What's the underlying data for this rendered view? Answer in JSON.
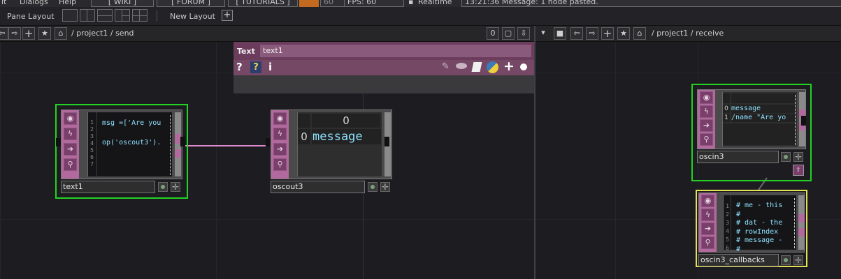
{
  "menubar": {
    "items": [
      "it",
      "Dialogs",
      "Help"
    ],
    "buttons": [
      "[ WIKI ]",
      "[ FORUM ]",
      "[ TUTORIALS ]",
      "60",
      "FPS:  60"
    ],
    "realtime_label": "Realtime",
    "status_message": "13:21:36 Message: 1 node pasted."
  },
  "layoutbar": {
    "pane_layout_label": "Pane Layout",
    "new_layout_label": "New Layout",
    "plus": "+"
  },
  "left_pane": {
    "path": "/ project1 / send",
    "zero_button": "0"
  },
  "right_pane": {
    "path": "/ project1 / receive"
  },
  "params": {
    "type_label": "Text",
    "name_value": "text1",
    "help_q": "?",
    "help_py": "?",
    "info": "i"
  },
  "nodes": {
    "text1": {
      "name": "text1",
      "line_numbers": [
        "1",
        "2",
        "3",
        "4",
        "5",
        "6",
        "7"
      ],
      "code": "msg =['Are you\n\nop('oscout3')."
    },
    "oscout3": {
      "name": "oscout3",
      "col_header": "0",
      "row_index": "0",
      "cell": "message"
    },
    "oscin3": {
      "name": "oscin3",
      "row_indices": [
        "0",
        "1"
      ],
      "rows": [
        "message",
        "/name \"Are yo"
      ]
    },
    "oscin3_callbacks": {
      "name": "oscin3_callbacks",
      "line_numbers": [
        "1",
        "2",
        "3",
        "4",
        "5",
        "6"
      ],
      "code": "# me - this\n#\n# dat - the\n# rowIndex\n# message -\n#"
    }
  },
  "colors": {
    "dat_family": "#b26a9e",
    "selected": "#23d323",
    "current": "#e6e055",
    "wire": "#e08ad0"
  }
}
